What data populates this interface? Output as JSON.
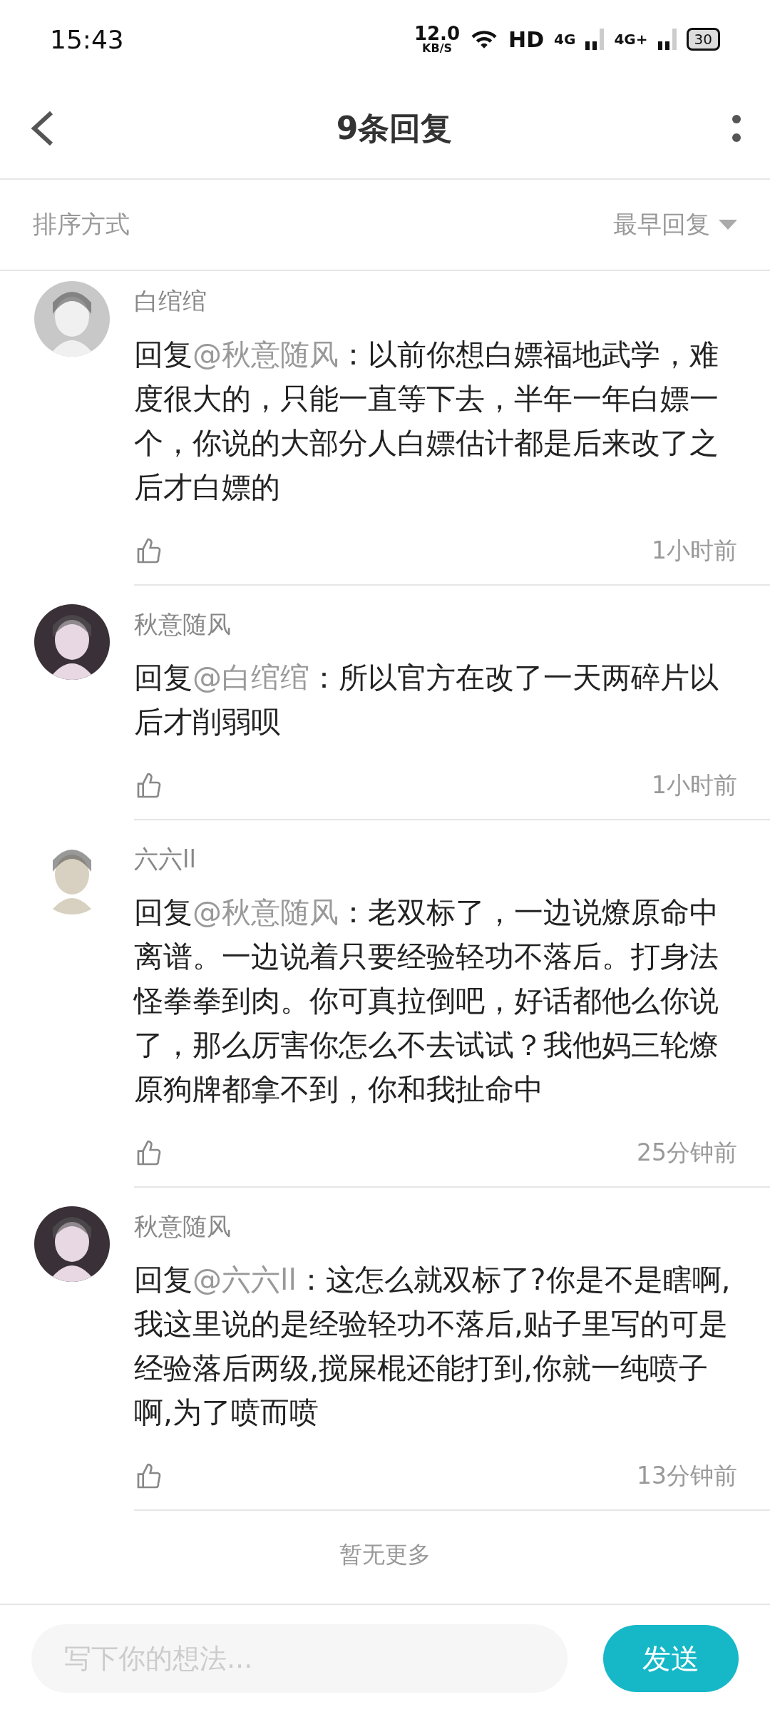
{
  "status_bar": {
    "time": "15:43",
    "speed": "12.0",
    "speed_unit": "KB/S",
    "hd": "HD",
    "network_1": "4G",
    "network_2": "4G+",
    "battery": "30"
  },
  "header": {
    "title": "9条回复"
  },
  "sort": {
    "label": "排序方式",
    "value": "最早回复"
  },
  "comments": [
    {
      "name": "白绾绾",
      "prefix": "回复",
      "mention": "@秋意随风",
      "text": "：以前你想白嫖福地武学，难度很大的，只能一直等下去，半年一年白嫖一个，你说的大部分人白嫖估计都是后来改了之后才白嫖的",
      "time": "1小时前",
      "liked": false
    },
    {
      "name": "秋意随风",
      "prefix": "回复",
      "mention": "@白绾绾",
      "text": "：所以官方在改了一天两碎片以后才削弱呗",
      "time": "1小时前",
      "liked": false
    },
    {
      "name": "六六ll",
      "prefix": "回复",
      "mention": "@秋意随风",
      "text": "：老双标了，一边说燎原命中离谱。一边说着只要经验轻功不落后。打身法怪拳拳到肉。你可真拉倒吧，好话都他么你说了，那么厉害你怎么不去试试？我他妈三轮燎原狗牌都拿不到，你和我扯命中",
      "time": "25分钟前",
      "liked": false
    },
    {
      "name": "秋意随风",
      "prefix": "回复",
      "mention": "@六六ll",
      "text": "：这怎么就双标了?你是不是瞎啊,我这里说的是经验轻功不落后,贴子里写的可是经验落后两级,搅屎棍还能打到,你就一纯喷子啊,为了喷而喷",
      "time": "13分钟前",
      "liked": false
    }
  ],
  "end_note": "暂无更多",
  "composer": {
    "placeholder": "写下你的想法...",
    "send": "发送"
  }
}
